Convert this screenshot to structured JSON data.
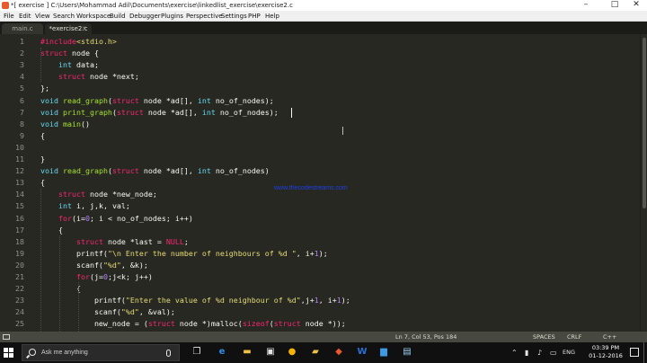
{
  "window": {
    "title": "*[ exercise ] C:\\Users\\Mohammad Adil\\Documents\\exercise\\linkedlist_exercise\\exercise2.c",
    "minimize": "–",
    "maximize": "□",
    "close": "✕"
  },
  "menu": [
    "File",
    "Edit",
    "View",
    "Search",
    "Workspace",
    "Build",
    "Debugger",
    "Plugins",
    "Perspective",
    "Settings",
    "PHP",
    "Help"
  ],
  "tabs": [
    {
      "label": "main.c",
      "active": false
    },
    {
      "label": "*exercise2.c",
      "active": true,
      "close": "×"
    }
  ],
  "editor": {
    "line_numbers": [
      "1",
      "2",
      "3",
      "4",
      "5",
      "6",
      "7",
      "8",
      "9",
      "10",
      "11",
      "12",
      "13",
      "14",
      "15",
      "16",
      "17",
      "18",
      "19",
      "20",
      "21",
      "22",
      "23",
      "24",
      "25"
    ],
    "lines": [
      "#include<stdio.h>",
      "struct node {",
      "    int data;",
      "    struct node *next;",
      "};",
      "void read_graph(struct node *ad[], int no_of_nodes);",
      "void print_graph(struct node *ad[], int no_of_nodes);",
      "void main()",
      "{",
      "",
      "}",
      "void read_graph(struct node *ad[], int no_of_nodes)",
      "{",
      "    struct node *new_node;",
      "    int i, j,k, val;",
      "    for(i=0; i < no_of_nodes; i++)",
      "    {",
      "        struct node *last = NULL;",
      "        printf(\"\\n Enter the number of neighbours of %d \", i+1);",
      "        scanf(\"%d\", &k);",
      "        for(j=0;j<k; j++)",
      "        {",
      "            printf(\"Enter the value of %d neighbour of %d\",j+1, i+1);",
      "            scanf(\"%d\", &val);",
      "            new_node = (struct node *)malloc(sizeof(struct node *));"
    ],
    "watermark": "www.thecodestreams.com"
  },
  "status": {
    "position": "Ln 7, Col 53, Pos 184",
    "indent": "SPACES",
    "line_ending": "CRLF",
    "syntax": "C++"
  },
  "taskbar": {
    "search_placeholder": "Ask me anything",
    "language": "ENG",
    "time": "03:39 PM",
    "date": "01-12-2016"
  },
  "colors": {
    "background": "#272822",
    "foreground": "#f8f8f2",
    "keyword": "#f92672",
    "type": "#66d9ef",
    "string": "#e6db74",
    "number": "#ae81ff",
    "function": "#a6e22e",
    "line_number": "#8f908a",
    "watermark": "#1d3fe6"
  }
}
